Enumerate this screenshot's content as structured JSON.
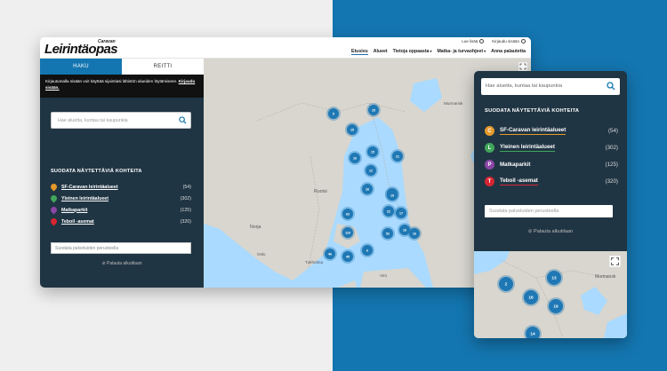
{
  "brand": {
    "logo_small": "Caravan",
    "logo_big": "Leirintäopas"
  },
  "header": {
    "top_links": [
      "Lue lisää",
      "Kirjaudu sisään"
    ],
    "nav": [
      "Etusivu",
      "Alueet",
      "Tietoja oppaasta",
      "Matka- ja turvaohjeet",
      "Anna palautetta"
    ]
  },
  "sidebar": {
    "tabs": [
      "HAKU",
      "REITTI"
    ],
    "login_note": "Kirjautumalla sisään voit käyttää sijaintiasi lähistön alueiden löytämiseen.",
    "login_link": "Kirjaudu sisään.",
    "search_placeholder": "Hae aluetta, kuntaa tai kaupunkia",
    "filter_title": "SUODATA NÄYTETTÄVIÄ KOHTEITA",
    "filters": [
      {
        "label": "SF-Caravan leirintäalueet",
        "count": "(54)",
        "color": "#e49a2a"
      },
      {
        "label": "Yleinen leirintäalueet",
        "count": "(302)",
        "color": "#41a65b"
      },
      {
        "label": "Matkaparkit",
        "count": "(125)",
        "color": "#8b46a6"
      },
      {
        "label": "Teboil -asemat",
        "count": "(320)",
        "color": "#d62531"
      }
    ],
    "service_placeholder": "Suodata palveluiden perusteella",
    "reset": "Palauta alkutilaan"
  },
  "desktop_map": {
    "labels": [
      "Ruotsi",
      "Norja",
      "Tukholma",
      "Oslo",
      "Viro",
      "Murmansk"
    ],
    "clusters": [
      "5",
      "15",
      "15",
      "15",
      "16",
      "14",
      "12",
      "19",
      "21",
      "16",
      "17",
      "22",
      "63",
      "119",
      "52",
      "16",
      "6",
      "46",
      "45",
      "16"
    ]
  },
  "mobile": {
    "search_placeholder": "Hae aluetta, kuntaa tai kaupunkia",
    "filter_title": "SUODATA NÄYTETTÄVIÄ KOHTEITA",
    "filters": [
      {
        "label": "SF-Caravan leirintäalueet",
        "count": "(54)",
        "color": "#e49a2a",
        "glyph": "C"
      },
      {
        "label": "Yleinen leirintäalueet",
        "count": "(302)",
        "color": "#41a65b",
        "glyph": "L"
      },
      {
        "label": "Matkaparkit",
        "count": "(125)",
        "color": "#8b46a6",
        "glyph": "P"
      },
      {
        "label": "Teboil -asemat",
        "count": "(320)",
        "color": "#d62531",
        "glyph": "T"
      }
    ],
    "service_placeholder": "Suodata palveluiden perusteella",
    "reset": "Palauta alkutilaan",
    "map_labels": [
      "Murmansk"
    ],
    "clusters": [
      "2",
      "13",
      "16",
      "19",
      "14"
    ]
  },
  "colors": {
    "accent_blue": "#1476b0",
    "sidebar_bg": "#203544",
    "cluster_blue": "#1f78b4",
    "land": "#d8d6cf"
  }
}
